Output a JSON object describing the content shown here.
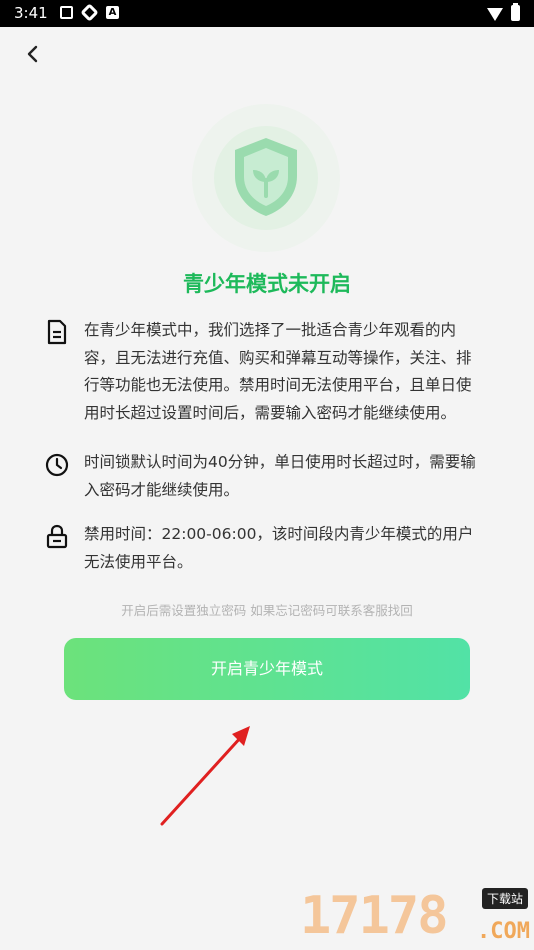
{
  "status_bar": {
    "time": "3:41",
    "icons": [
      "notification-icon",
      "app-icon",
      "a-icon"
    ]
  },
  "page": {
    "title": "青少年模式未开启",
    "items": [
      {
        "icon": "document-icon",
        "text": "在青少年模式中，我们选择了一批适合青少年观看的内容，且无法进行充值、购买和弹幕互动等操作，关注、排行等功能也无法使用。禁用时间无法使用平台，且单日使用时长超过设置时间后，需要输入密码才能继续使用。"
      },
      {
        "icon": "clock-icon",
        "text": "时间锁默认时间为40分钟，单日使用时长超过时，需要输入密码才能继续使用。"
      },
      {
        "icon": "lock-icon",
        "text": "禁用时间：22:00-06:00，该时间段内青少年模式的用户无法使用平台。"
      }
    ],
    "hint": "开启后需设置独立密码 如果忘记密码可联系客服找回",
    "button_label": "开启青少年模式"
  },
  "watermark": {
    "digits": "17178",
    "badge": "下载站",
    "suffix": ".COM"
  },
  "colors": {
    "accent": "#1db95a",
    "button_start": "#6ce27b",
    "button_end": "#52e2a6",
    "arrow": "#e02020"
  }
}
